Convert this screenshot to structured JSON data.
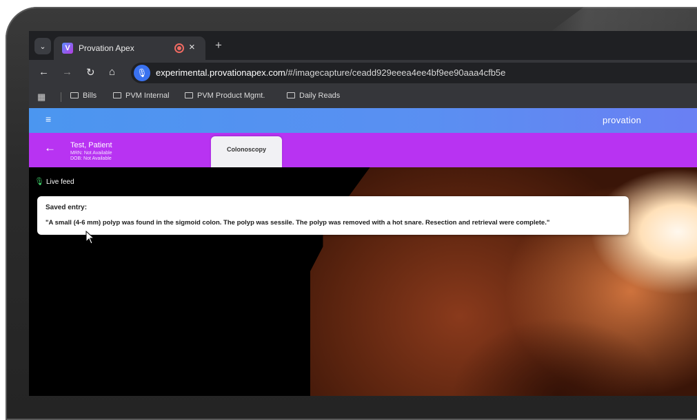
{
  "browser": {
    "tab_title": "Provation Apex",
    "tab_favicon_letter": "V",
    "url_host": "experimental.provationapex.com",
    "url_path": "/#/imagecapture/ceadd929eeea4ee4bf9ee90aaa4cfb5e",
    "bookmarks": [
      "Bills",
      "PVM Internal",
      "PVM Product Mgmt.",
      "Daily Reads"
    ]
  },
  "app": {
    "brand": "provation",
    "patient": {
      "name": "Test, Patient",
      "mrn": "MRN: Not Available",
      "dob": "DOB: Not Available"
    },
    "procedure_tab": "Colonoscopy",
    "live_feed_label": "Live feed",
    "saved_entry": {
      "title": "Saved entry:",
      "text": "\"A small (4-6 mm) polyp was found in the sigmoid colon. The polyp was sessile. The polyp was removed with a hot snare. Resection and retrieval were complete.\""
    }
  },
  "colors": {
    "app_header": "#4b96f0",
    "patient_bar": "#b833f2",
    "mic_button": "#3a72f0",
    "record_indicator": "#ef6a62",
    "live_mic": "#3fd06a"
  },
  "icons": [
    "tab-search-icon",
    "record-icon",
    "close-icon",
    "new-tab-icon",
    "back-icon",
    "forward-icon",
    "reload-icon",
    "home-icon",
    "microphone-icon",
    "apps-grid-icon",
    "folder-icon",
    "hamburger-menu-icon",
    "arrow-left-icon",
    "cursor-icon"
  ]
}
